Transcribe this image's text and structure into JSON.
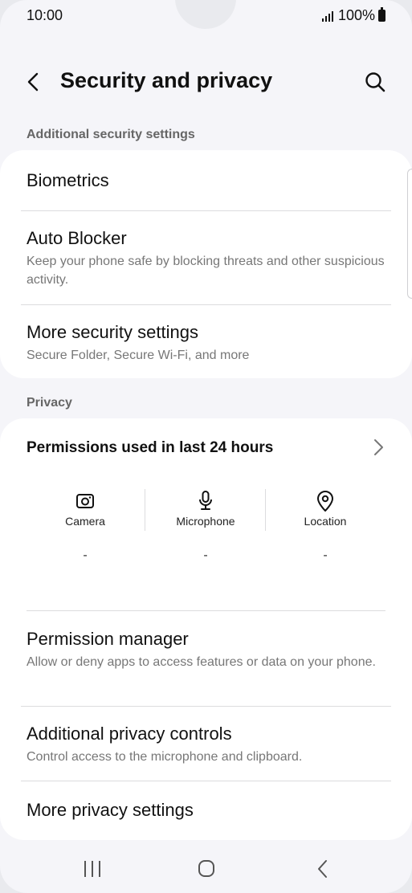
{
  "status_bar": {
    "time": "10:00",
    "battery": "100%"
  },
  "header": {
    "title": "Security and privacy"
  },
  "sections": {
    "additional": {
      "label": "Additional security settings",
      "items": [
        {
          "title": "Biometrics"
        },
        {
          "title": "Auto Blocker",
          "subtitle": "Keep your phone safe by blocking threats and other suspicious activity."
        },
        {
          "title": "More security settings",
          "subtitle": "Secure Folder, Secure Wi-Fi, and more"
        }
      ]
    },
    "privacy": {
      "label": "Privacy",
      "permissions": {
        "title": "Permissions used in last 24 hours",
        "columns": [
          {
            "label": "Camera",
            "value": "-",
            "icon": "camera-icon"
          },
          {
            "label": "Microphone",
            "value": "-",
            "icon": "microphone-icon"
          },
          {
            "label": "Location",
            "value": "-",
            "icon": "location-pin-icon"
          }
        ]
      },
      "items": [
        {
          "title": "Permission manager",
          "subtitle": "Allow or deny apps to access features or data on your phone."
        },
        {
          "title": "Additional privacy controls",
          "subtitle": "Control access to the microphone and clipboard."
        },
        {
          "title": "More privacy settings"
        }
      ]
    }
  },
  "navbar": {
    "icons": [
      "recents-icon",
      "home-icon",
      "back-icon"
    ]
  }
}
